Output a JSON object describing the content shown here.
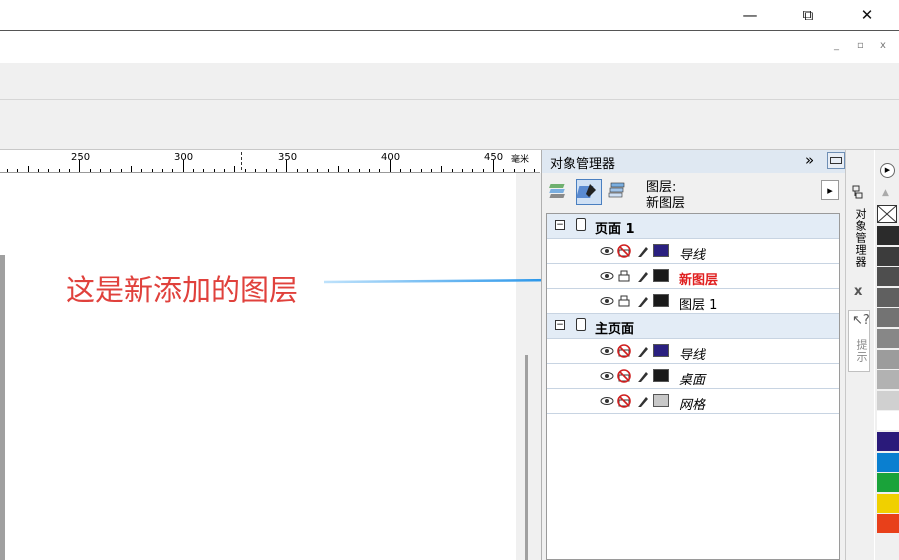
{
  "window": {
    "minimize_glyph": "—",
    "restore_glyph": "⧉",
    "close_glyph": "✕",
    "mdi_minimize": "_",
    "mdi_restore": "▫",
    "mdi_close": "x"
  },
  "ruler": {
    "labels": [
      "250",
      "300",
      "350",
      "400",
      "450"
    ],
    "unit": "毫米"
  },
  "annotation": {
    "text": "这是新添加的图层",
    "color": "#e0413c",
    "arrow_color": "#1e90e8"
  },
  "panel": {
    "title": "对象管理器",
    "collapse_glyph": "»",
    "current_layer_label": "图层:",
    "current_layer_value": "新图层",
    "menu_arrow": "▸",
    "groups": [
      {
        "label": "页面 1",
        "layers": [
          {
            "name": "导线",
            "italic": true,
            "red": false,
            "printable": false,
            "swatch": "#2a2080"
          },
          {
            "name": "新图层",
            "italic": false,
            "red": true,
            "printable": true,
            "swatch": "#1a1a1a"
          },
          {
            "name": "图层 1",
            "italic": false,
            "red": false,
            "printable": true,
            "swatch": "#1a1a1a"
          }
        ]
      },
      {
        "label": "主页面",
        "layers": [
          {
            "name": "导线",
            "italic": true,
            "red": false,
            "printable": false,
            "swatch": "#2a2080"
          },
          {
            "name": "桌面",
            "italic": true,
            "red": false,
            "printable": false,
            "swatch": "#1a1a1a"
          },
          {
            "name": "网格",
            "italic": true,
            "red": false,
            "printable": false,
            "swatch": "#c8c8c8"
          }
        ]
      }
    ]
  },
  "side_tabs": {
    "object_manager_tab": "对象管理器",
    "close_glyph": "x",
    "hints_tab": "提示"
  },
  "palette": {
    "colors": [
      "#2b2b2b",
      "#3c3c3c",
      "#4e4e4e",
      "#606060",
      "#737373",
      "#878787",
      "#9c9c9c",
      "#b2b2b2",
      "#d0d0d0",
      "#ffffff",
      "#2a1a7a",
      "#0a7fd0",
      "#1aa33a",
      "#f0d000",
      "#e8401a"
    ]
  }
}
